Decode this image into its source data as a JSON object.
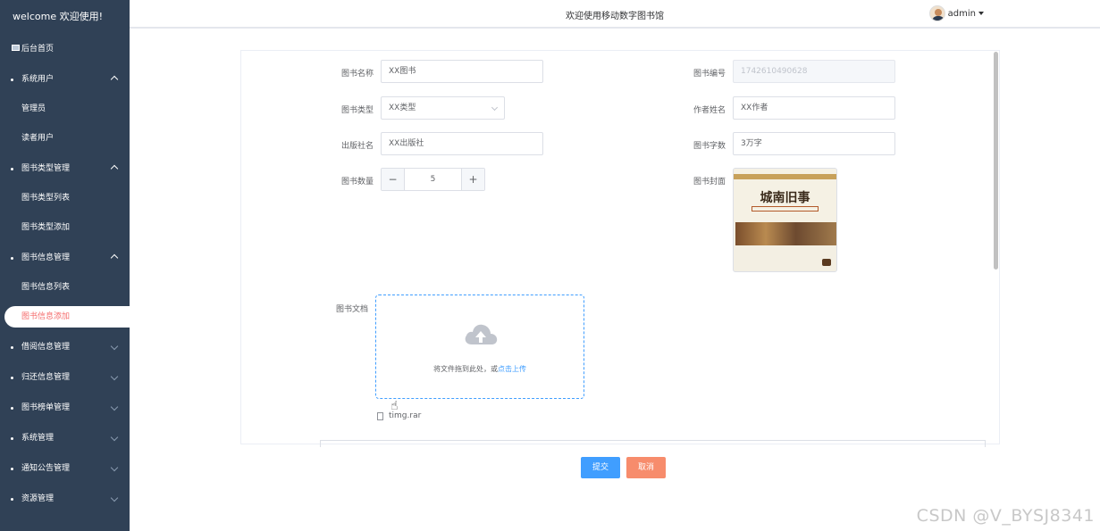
{
  "sidebar": {
    "title": "welcome 欢迎使用!",
    "home": "后台首页",
    "groups": [
      {
        "label": "系统用户",
        "items": [
          "管理员",
          "读者用户"
        ]
      },
      {
        "label": "图书类型管理",
        "items": [
          "图书类型列表",
          "图书类型添加"
        ]
      },
      {
        "label": "图书信息管理",
        "items": [
          "图书信息列表",
          "图书信息添加"
        ]
      },
      {
        "label": "借阅信息管理"
      },
      {
        "label": "归还信息管理"
      },
      {
        "label": "图书榜单管理"
      },
      {
        "label": "系统管理"
      },
      {
        "label": "通知公告管理"
      },
      {
        "label": "资源管理"
      }
    ]
  },
  "header": {
    "title": "欢迎使用移动数字图书馆",
    "user": "admin"
  },
  "form": {
    "name_label": "图书名称",
    "name_value": "XX图书",
    "code_label": "图书编号",
    "code_value": "1742610490628",
    "type_label": "图书类型",
    "type_value": "XX类型",
    "author_label": "作者姓名",
    "author_value": "XX作者",
    "publisher_label": "出版社名",
    "publisher_value": "XX出版社",
    "words_label": "图书字数",
    "words_value": "3万字",
    "qty_label": "图书数量",
    "qty_value": "5",
    "qty_minus": "−",
    "qty_plus": "+",
    "cover_label": "图书封面",
    "cover_title": "城南旧事",
    "doc_label": "图书文档",
    "upload_hint": "将文件拖到此处，或",
    "upload_link": "点击上传",
    "file_name": "timg.rar"
  },
  "actions": {
    "submit": "提交",
    "cancel": "取消"
  },
  "watermark": "CSDN @V_BYSJ8341",
  "colors": {
    "sidebar_bg": "#304156",
    "primary": "#409eff",
    "cancel": "#f78c6c",
    "active_text": "#f56c6c"
  }
}
